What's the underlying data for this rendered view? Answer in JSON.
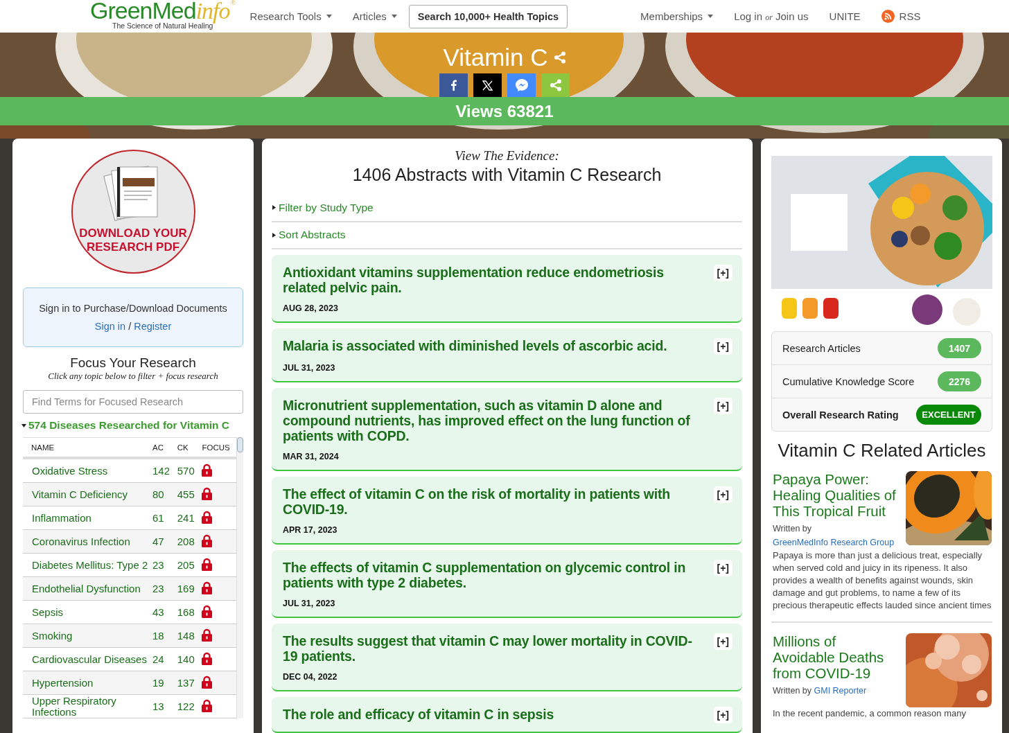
{
  "nav": {
    "logo": {
      "name": "GreenMed",
      "suffix": "info",
      "tagline": "The Science of Natural Healing",
      "mark": "®"
    },
    "left_items": [
      {
        "label": "Research Tools",
        "dropdown": true
      },
      {
        "label": "Articles",
        "dropdown": true
      }
    ],
    "search_button": "Search 10,000+ Health Topics",
    "right_items": [
      {
        "kind": "menu",
        "label": "Memberships"
      },
      {
        "kind": "link",
        "label": "Log in *or* Join us"
      },
      {
        "kind": "link",
        "label": "UNITE"
      },
      {
        "kind": "rss",
        "label": "RSS"
      }
    ]
  },
  "hero": {
    "title": "Vitamin C",
    "share_buttons": [
      {
        "kind": "facebook"
      },
      {
        "kind": "x"
      },
      {
        "kind": "messenger"
      },
      {
        "kind": "share"
      }
    ],
    "views": "Views 63821"
  },
  "left": {
    "download": "DOWNLOAD YOUR RESEARCH PDF",
    "signin": {
      "text": "Sign in to Purchase/Download Documents",
      "sign_in": "Sign in",
      "separator": "/",
      "register": "Register"
    },
    "focus_title": "Focus Your Research",
    "focus_subtitle": "Click any topic below to filter + focus research",
    "search": {
      "placeholder": "Find Terms for Focused Research"
    },
    "diseases": {
      "title": "574 Diseases Researched for Vitamin C",
      "expanded": true,
      "columns": [
        "NAME",
        "AC",
        "CK",
        "FOCUS"
      ],
      "rows": [
        {
          "name": "Oxidative Stress",
          "ac": "142",
          "ck": "570"
        },
        {
          "name": "Vitamin C Deficiency",
          "ac": "80",
          "ck": "455"
        },
        {
          "name": "Inflammation",
          "ac": "61",
          "ck": "241"
        },
        {
          "name": "Coronavirus Infection",
          "ac": "47",
          "ck": "208"
        },
        {
          "name": "Diabetes Mellitus: Type 2",
          "ac": "23",
          "ck": "205"
        },
        {
          "name": "Endothelial Dysfunction",
          "ac": "23",
          "ck": "169"
        },
        {
          "name": "Sepsis",
          "ac": "43",
          "ck": "168"
        },
        {
          "name": "Smoking",
          "ac": "18",
          "ck": "148"
        },
        {
          "name": "Cardiovascular Diseases",
          "ac": "24",
          "ck": "140"
        },
        {
          "name": "Hypertension",
          "ac": "19",
          "ck": "137"
        },
        {
          "name": "Upper Respiratory Infections",
          "ac": "13",
          "ck": "122"
        }
      ]
    }
  },
  "center": {
    "kicker": "View The Evidence:",
    "heading": "1406 Abstracts with Vitamin C Research",
    "toggles": [
      {
        "label": "Filter by Study Type",
        "expanded": false
      },
      {
        "label": "Sort Abstracts",
        "expanded": false
      }
    ],
    "abstracts": [
      {
        "title": "Antioxidant vitamins supplementation reduce endometriosis related pelvic pain.",
        "date": "AUG 28, 2023",
        "button": "[+]"
      },
      {
        "title": "Malaria is associated with diminished levels of ascorbic acid.",
        "date": "JUL 31, 2023",
        "button": "[+]"
      },
      {
        "title": "Micronutrient supplementation, such as vitamin D alone and compound nutrients, has improved effect on the lung function of patients with COPD.",
        "date": "MAR 31, 2024",
        "button": "[+]"
      },
      {
        "title": "The effect of vitamin C on the risk of mortality in patients with COVID-19.",
        "date": "APR 17, 2023",
        "button": "[+]"
      },
      {
        "title": "The effects of vitamin C supplementation on glycemic control in patients with type 2 diabetes.",
        "date": "JUL 31, 2023",
        "button": "[+]"
      },
      {
        "title": "The results suggest that vitamin C may lower mortality in COVID-19 patients.",
        "date": "DEC 04, 2022",
        "button": "[+]"
      },
      {
        "title": "The role and efficacy of vitamin C in sepsis",
        "button": "[+]"
      }
    ]
  },
  "right": {
    "stats": [
      {
        "label": "Research Articles",
        "value": "1407",
        "kind": "count"
      },
      {
        "label": "Cumulative Knowledge Score",
        "value": "2276",
        "kind": "count"
      },
      {
        "label": "Overall Research Rating",
        "value": "EXCELLENT",
        "kind": "rating"
      }
    ],
    "related_title": "Vitamin C Related Articles",
    "articles": [
      {
        "title": "Papaya Power: Healing Qualities of This Tropical Fruit",
        "written_by": "Written by",
        "author": "GreenMedInfo Research Group",
        "summary": "Papaya is more than just a delicious treat, especially when served cold and juicy in its ripeness. It also provides a wealth of benefits against wounds, skin damage and gut problems, to name a few of its precious therapeutic effects lauded since ancient times"
      },
      {
        "title": "Millions of Avoidable Deaths from COVID-19",
        "written_by": "Written by",
        "author": "GMI Reporter",
        "summary": "In the recent pandemic, a common reason many"
      }
    ]
  }
}
